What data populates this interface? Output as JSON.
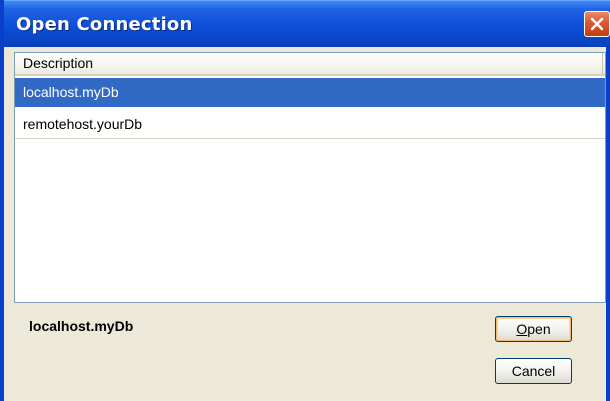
{
  "window": {
    "title": "Open Connection"
  },
  "list": {
    "column_header": "Description",
    "rows": [
      {
        "label": "localhost.myDb",
        "selected": true
      },
      {
        "label": "remotehost.yourDb",
        "selected": false
      }
    ]
  },
  "footer": {
    "selected_text": "localhost.myDb",
    "open_label_mnemonic": "O",
    "open_label_rest": "pen",
    "cancel_label": "Cancel"
  },
  "icons": {
    "close": "close-icon"
  },
  "colors": {
    "titlebar": "#0c4fd6",
    "selection": "#316ac5",
    "close_button": "#d85a32",
    "window_bg": "#ece9d8"
  }
}
